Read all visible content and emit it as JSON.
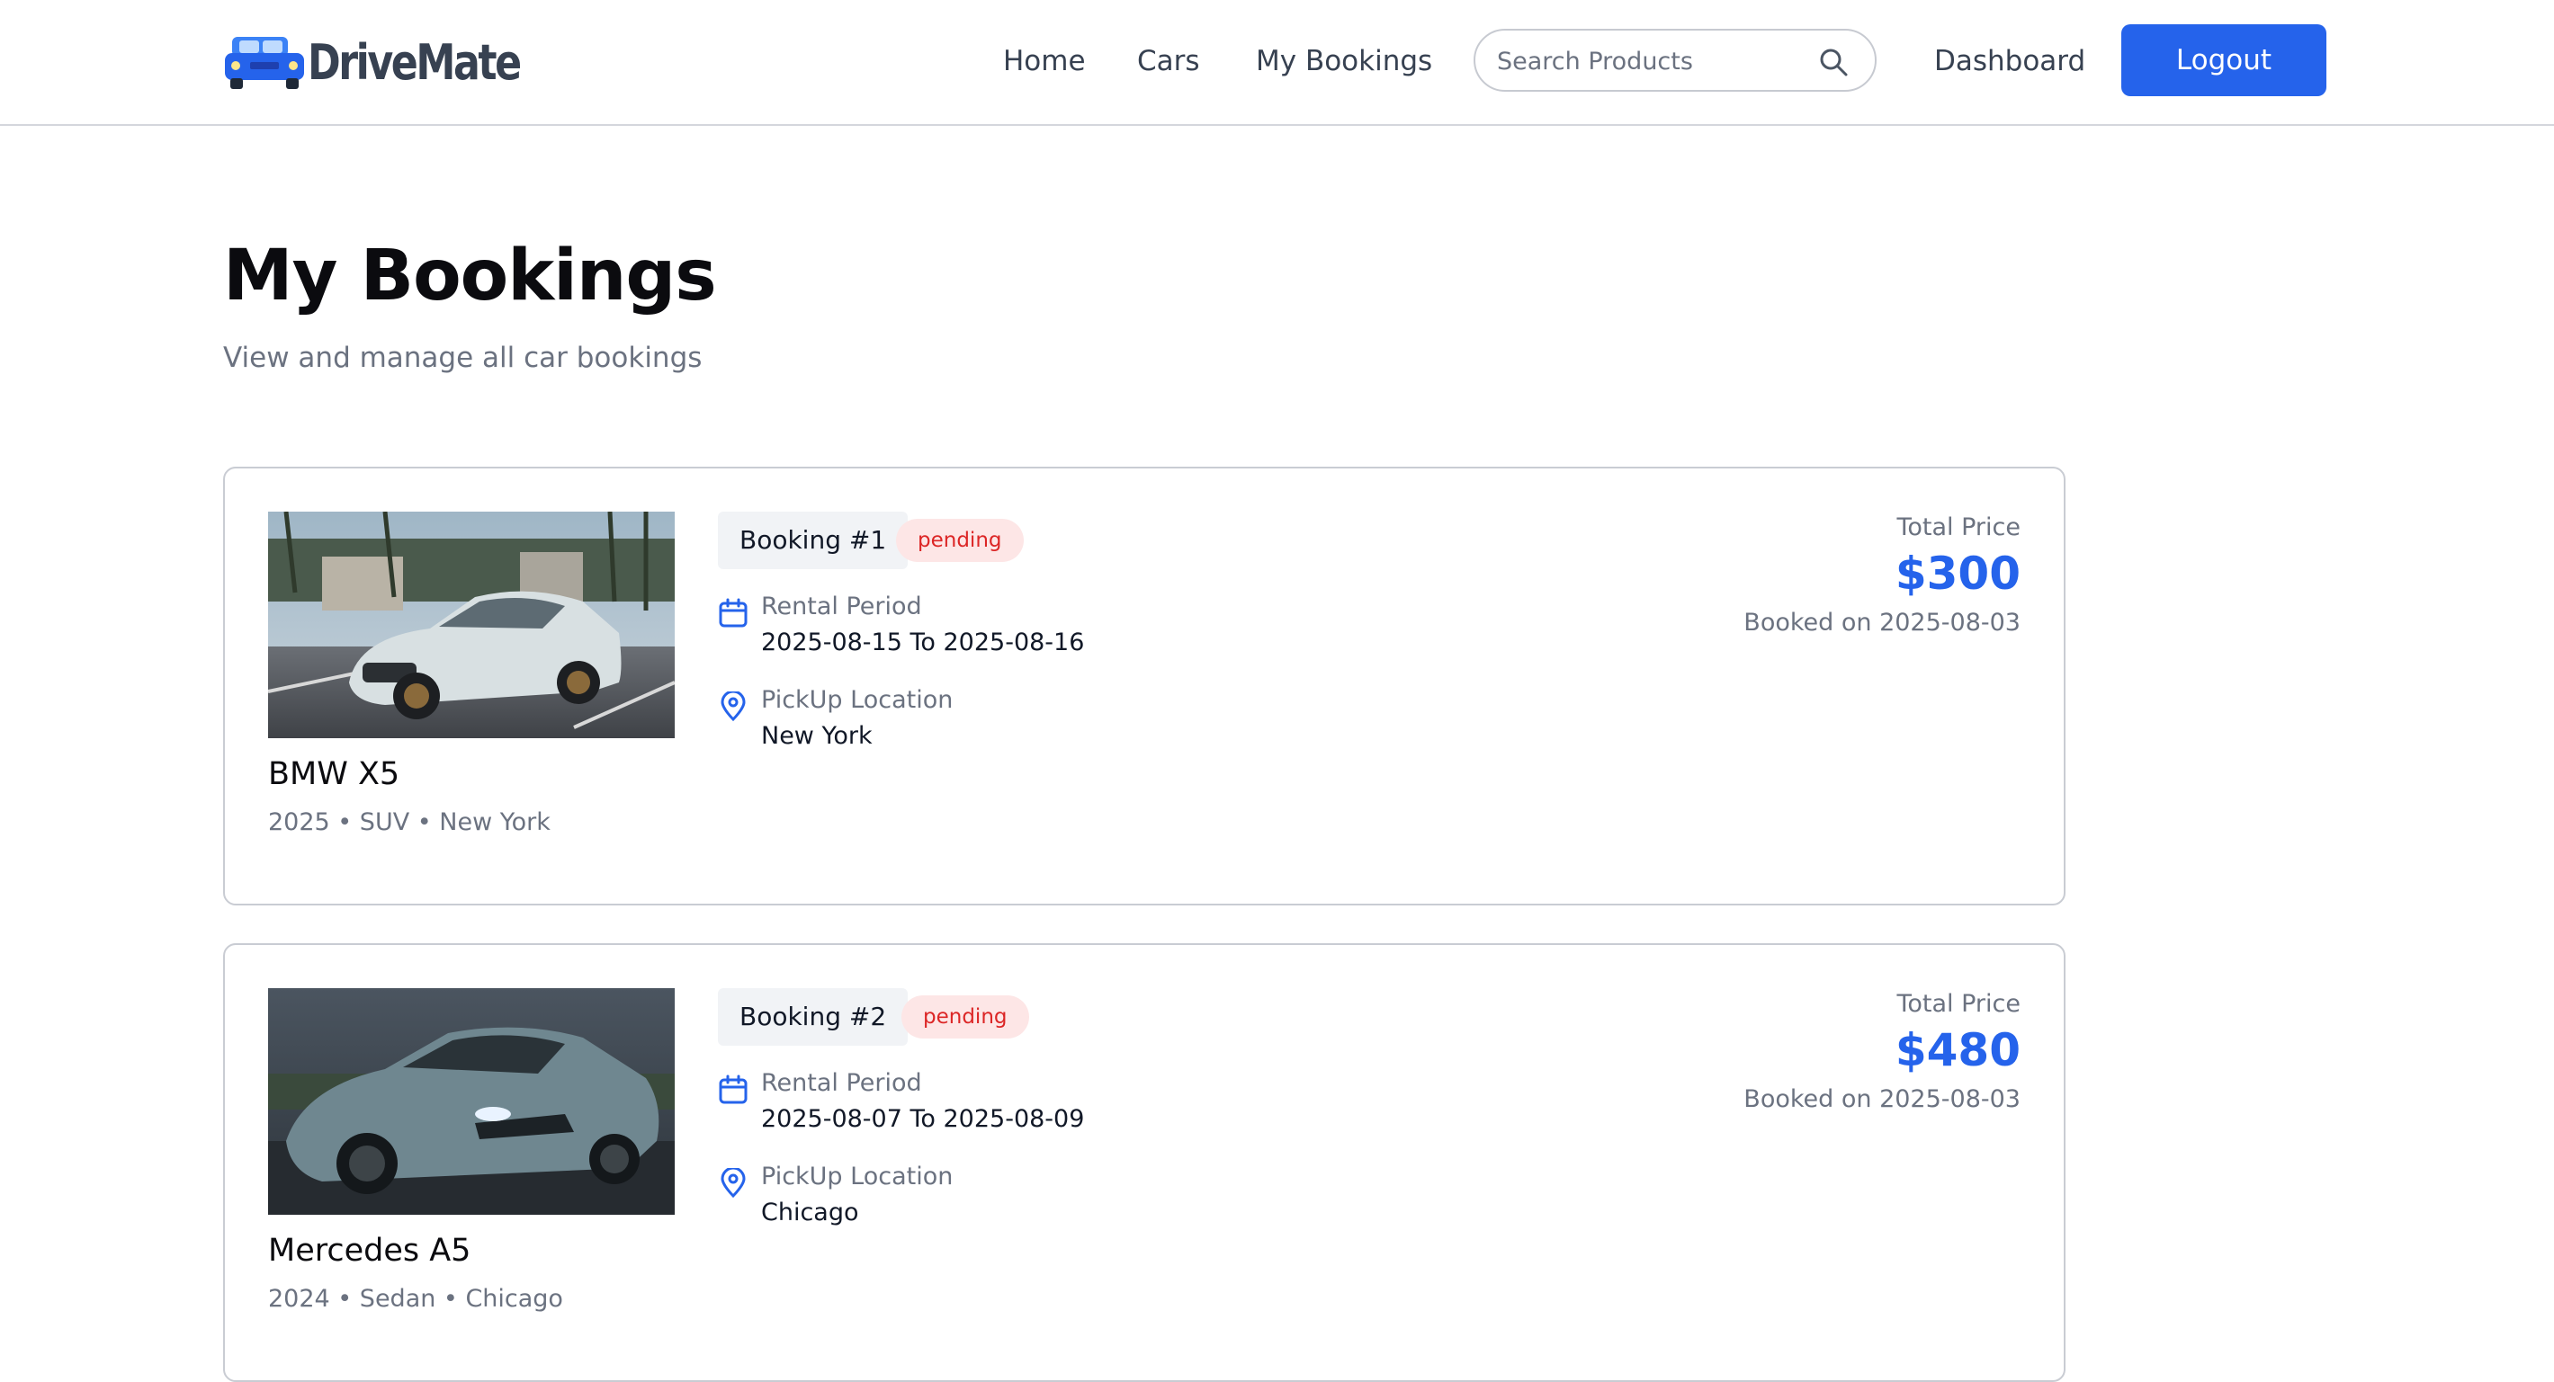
{
  "brand": {
    "name": "DriveMate",
    "accent": "#2563eb",
    "logo_icon": "car-icon"
  },
  "nav": {
    "links": [
      "Home",
      "Cars",
      "My Bookings"
    ],
    "search_placeholder": "Search Products",
    "dashboard": "Dashboard",
    "logout": "Logout"
  },
  "page": {
    "title": "My Bookings",
    "subtitle": "View and manage all car bookings"
  },
  "bookings": [
    {
      "car_name": "BMW X5",
      "car_meta": "2025 • SUV • New York",
      "tag": "Booking #1",
      "status": "pending",
      "rental_label": "Rental Period",
      "rental_value": "2025-08-15 To 2025-08-16",
      "pickup_label": "PickUp Location",
      "pickup_value": "New York",
      "price_label": "Total Price",
      "price": "$300",
      "booked_on": "Booked on 2025-08-03"
    },
    {
      "car_name": "Mercedes A5",
      "car_meta": "2024 • Sedan • Chicago",
      "tag": "Booking #2",
      "status": "pending",
      "rental_label": "Rental Period",
      "rental_value": "2025-08-07 To 2025-08-09",
      "pickup_label": "PickUp Location",
      "pickup_value": "Chicago",
      "price_label": "Total Price",
      "price": "$480",
      "booked_on": "Booked on 2025-08-03"
    }
  ]
}
